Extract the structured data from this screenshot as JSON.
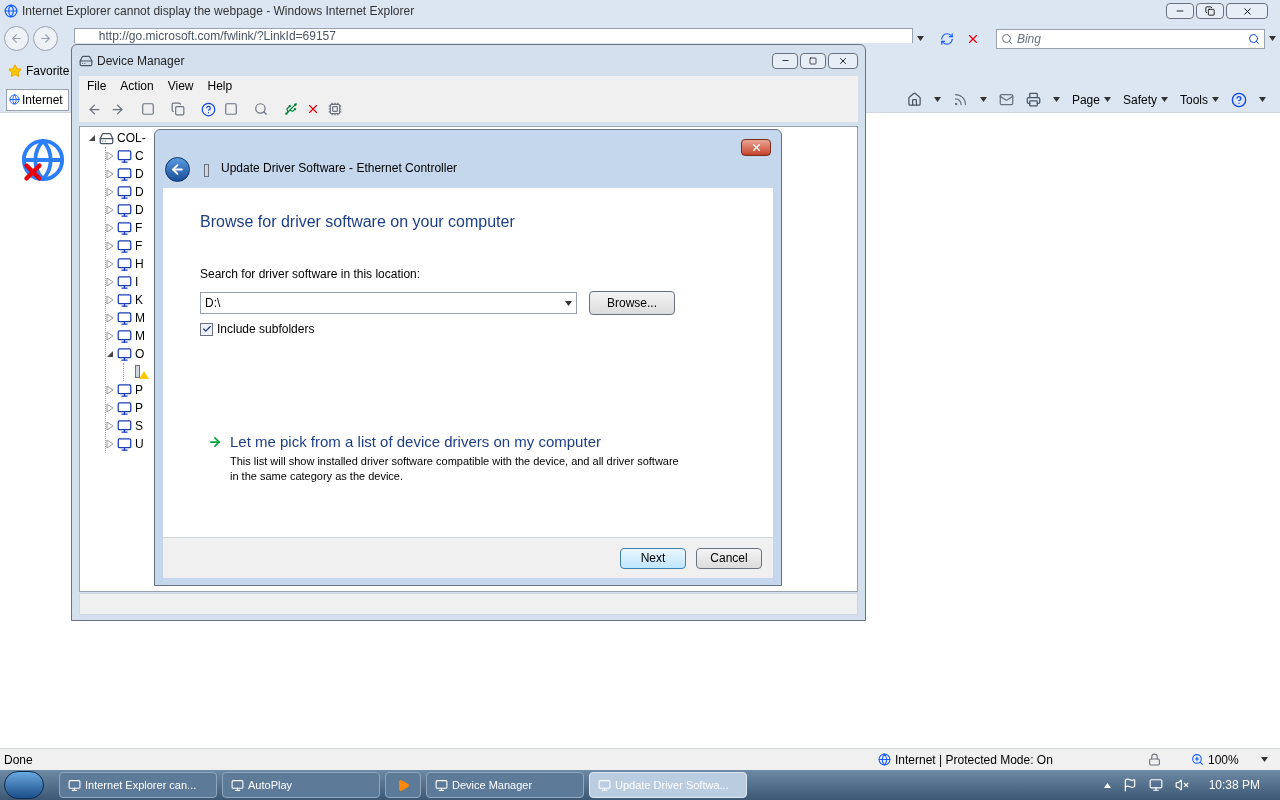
{
  "browser": {
    "title": "Internet Explorer cannot display the webpage - Windows Internet Explorer",
    "address": "http://go.microsoft.com/fwlink/?LinkId=69157",
    "search": {
      "placeholder": "Bing"
    },
    "favorites_label": "Favorite",
    "tab_label": "Internet",
    "command_menus": [
      "Page",
      "Safety",
      "Tools"
    ],
    "status": "Done",
    "zone": "Internet | Protected Mode: On",
    "zoom": "100%"
  },
  "device_manager": {
    "title": "Device Manager",
    "menus": [
      "File",
      "Action",
      "View",
      "Help"
    ],
    "tree": {
      "label": "COL-",
      "expanded": true,
      "children": [
        {
          "label": "C",
          "expanded": false
        },
        {
          "label": "D",
          "expanded": false
        },
        {
          "label": "D",
          "expanded": false
        },
        {
          "label": "D",
          "expanded": false
        },
        {
          "label": "F",
          "expanded": false
        },
        {
          "label": "F",
          "expanded": false
        },
        {
          "label": "H",
          "expanded": false
        },
        {
          "label": "I",
          "expanded": false
        },
        {
          "label": "K",
          "expanded": false
        },
        {
          "label": "M",
          "expanded": false
        },
        {
          "label": "M",
          "expanded": false
        },
        {
          "label": "O",
          "expanded": true,
          "children": [
            {
              "warning": true
            }
          ]
        },
        {
          "label": "P",
          "expanded": false
        },
        {
          "label": "P",
          "expanded": false
        },
        {
          "label": "S",
          "expanded": false
        },
        {
          "label": "U",
          "expanded": false
        }
      ]
    }
  },
  "dialog": {
    "title": "Update Driver Software - Ethernet Controller",
    "heading": "Browse for driver software on your computer",
    "location_label": "Search for driver software in this location:",
    "location_value": "D:\\",
    "browse_button": "Browse...",
    "include_subfolders": {
      "label": "Include subfolders",
      "checked": true
    },
    "pick_link": "Let me pick from a list of device drivers on my computer",
    "pick_description": "This list will show installed driver software compatible with the device, and all driver software in the same category as the device.",
    "buttons": [
      {
        "label": "Next",
        "selected": true
      },
      {
        "label": "Cancel",
        "selected": false
      }
    ]
  },
  "taskbar": {
    "items": [
      {
        "kind": "window",
        "label": "Internet Explorer can...",
        "selected": false
      },
      {
        "kind": "window",
        "label": "AutoPlay",
        "selected": false
      },
      {
        "kind": "icon",
        "selected": false
      },
      {
        "kind": "window",
        "label": "Device Manager",
        "selected": false
      },
      {
        "kind": "window",
        "label": "Update Driver Softwa...",
        "selected": true
      }
    ],
    "clock": "10:38 PM"
  }
}
